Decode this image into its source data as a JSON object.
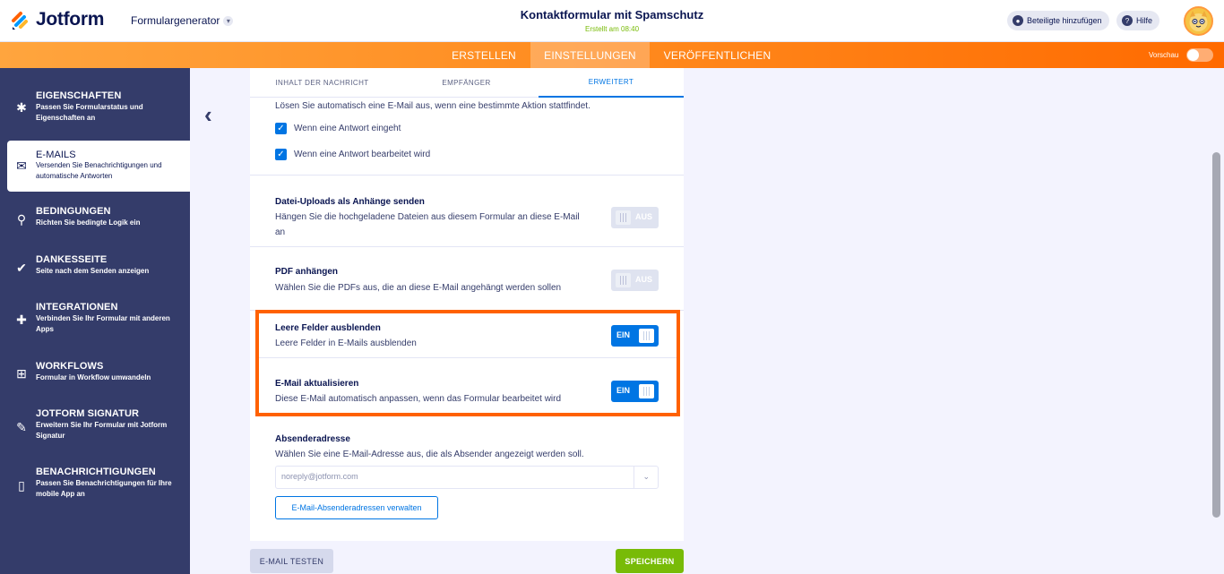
{
  "header": {
    "logo_text": "Jotform",
    "builder_label": "Formulargenerator",
    "form_title": "Kontaktformular mit Spamschutz",
    "form_created": "Erstellt am 08:40",
    "add_participants": "Beteiligte hinzufügen",
    "help": "Hilfe"
  },
  "nav": {
    "tabs": [
      "ERSTELLEN",
      "EINSTELLUNGEN",
      "VERÖFFENTLICHEN"
    ],
    "active": "EINSTELLUNGEN",
    "preview_label": "Vorschau"
  },
  "sidebar": {
    "items": [
      {
        "title": "EIGENSCHAFTEN",
        "desc": "Passen Sie Formularstatus und Eigenschaften an",
        "icon": "gear-icon"
      },
      {
        "title": "E-MAILS",
        "desc": "Versenden Sie Benachrichtigungen und automatische Antworten",
        "icon": "envelope-icon"
      },
      {
        "title": "BEDINGUNGEN",
        "desc": "Richten Sie bedingte Logik ein",
        "icon": "sitemap-icon"
      },
      {
        "title": "DANKESSEITE",
        "desc": "Seite nach dem Senden anzeigen",
        "icon": "check-circle-icon"
      },
      {
        "title": "INTEGRATIONEN",
        "desc": "Verbinden Sie Ihr Formular mit anderen Apps",
        "icon": "puzzle-icon"
      },
      {
        "title": "WORKFLOWS",
        "desc": "Formular in Workflow umwandeln",
        "icon": "workflow-icon"
      },
      {
        "title": "JOTFORM SIGNATUR",
        "desc": "Erweitern Sie Ihr Formular mit Jotform Signatur",
        "icon": "signature-icon"
      },
      {
        "title": "BENACHRICHTIGUNGEN",
        "desc": "Passen Sie Benachrichtigungen für Ihre mobile App an",
        "icon": "mobile-bell-icon"
      }
    ],
    "active": "E-MAILS"
  },
  "email_tabs": {
    "tabs": [
      "INHALT DER NACHRICHT",
      "EMPFÄNGER",
      "ERWEITERT"
    ],
    "active": "ERWEITERT"
  },
  "advanced": {
    "trigger_text": "Lösen Sie automatisch eine E-Mail aus, wenn eine bestimmte Aktion stattfindet.",
    "checkbox_1": "Wenn eine Antwort eingeht",
    "checkbox_2": "Wenn eine Antwort bearbeitet wird",
    "uploads_title": "Datei-Uploads als Anhänge senden",
    "uploads_desc_1": "Hängen Sie die hochgeladene Dateien aus diesem Formular an diese E-Mail",
    "uploads_desc_2": "an",
    "pdf_title": "PDF anhängen",
    "pdf_desc": "Wählen Sie die PDFs aus, die an diese E-Mail angehängt werden sollen",
    "empty_title": "Leere Felder ausblenden",
    "empty_desc": "Leere Felder in E-Mails ausblenden",
    "update_title": "E-Mail aktualisieren",
    "update_desc": "Diese E-Mail automatisch anpassen, wenn das Formular bearbeitet wird",
    "sender_title": "Absenderadresse",
    "sender_desc": "Wählen Sie eine E-Mail-Adresse aus, die als Absender angezeigt werden soll.",
    "sender_value": "noreply@jotform.com",
    "manage_button": "E-Mail-Absenderadressen verwalten",
    "toggle_off": "AUS",
    "toggle_on": "EIN"
  },
  "footer": {
    "test_button": "E-MAIL TESTEN",
    "save_button": "SPEICHERN"
  },
  "colors": {
    "accent": "#0075e3",
    "nav_orange": "#ff8a1e",
    "sidebar": "#343c6a",
    "save_green": "#78bb07",
    "highlight": "#ff6100"
  }
}
